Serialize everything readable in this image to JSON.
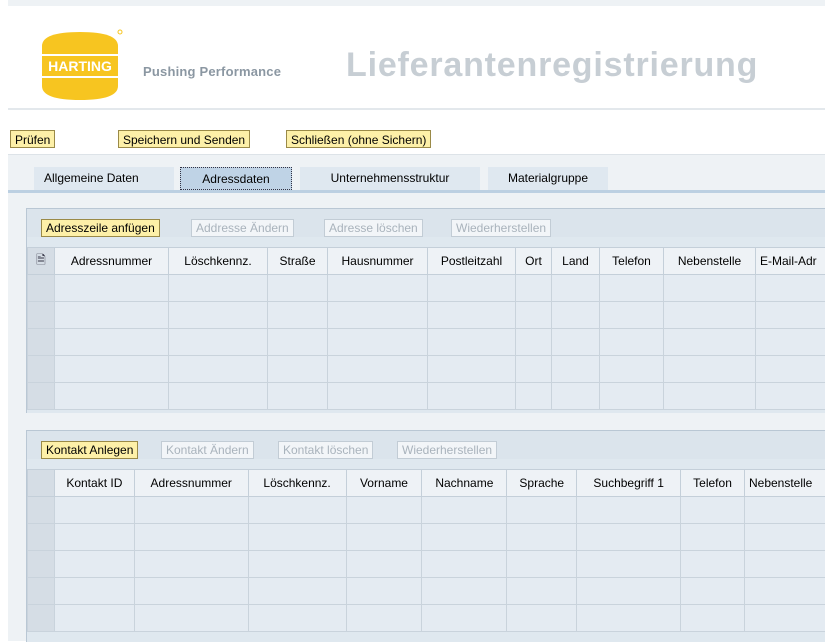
{
  "header": {
    "logo_text": "HARTING",
    "tagline": "Pushing Performance",
    "title": "Lieferantenregistrierung"
  },
  "toolbar": {
    "check_label": "Prüfen",
    "save_send_label": "Speichern und Senden",
    "close_label": "Schließen (ohne Sichern)"
  },
  "tabs": [
    {
      "label": "Allgemeine Daten"
    },
    {
      "label": "Adressdaten"
    },
    {
      "label": "Unternehmensstruktur"
    },
    {
      "label": "Materialgruppe"
    }
  ],
  "address_panel": {
    "buttons": {
      "add": "Adresszeile anfügen",
      "edit": "Addresse Ändern",
      "delete": "Adresse löschen",
      "restore": "Wiederherstellen"
    },
    "columns": [
      "Adressnummer",
      "Löschkennz.",
      "Straße",
      "Hausnummer",
      "Postleitzahl",
      "Ort",
      "Land",
      "Telefon",
      "Nebenstelle",
      "E-Mail-Adr"
    ]
  },
  "contact_panel": {
    "buttons": {
      "add": "Kontakt Anlegen",
      "edit": "Kontakt Ändern",
      "delete": "Kontakt löschen",
      "restore": "Wiederherstellen"
    },
    "columns": [
      "Kontakt ID",
      "Adressnummer",
      "Löschkennz.",
      "Vorname",
      "Nachname",
      "Sprache",
      "Suchbegriff 1",
      "Telefon",
      "Nebenstelle"
    ]
  },
  "colors": {
    "button_active_bg": "#fdf0a8",
    "logo_yellow": "#f7c520",
    "logo_text": "#ffffff",
    "title_gray": "#c7ced4"
  }
}
